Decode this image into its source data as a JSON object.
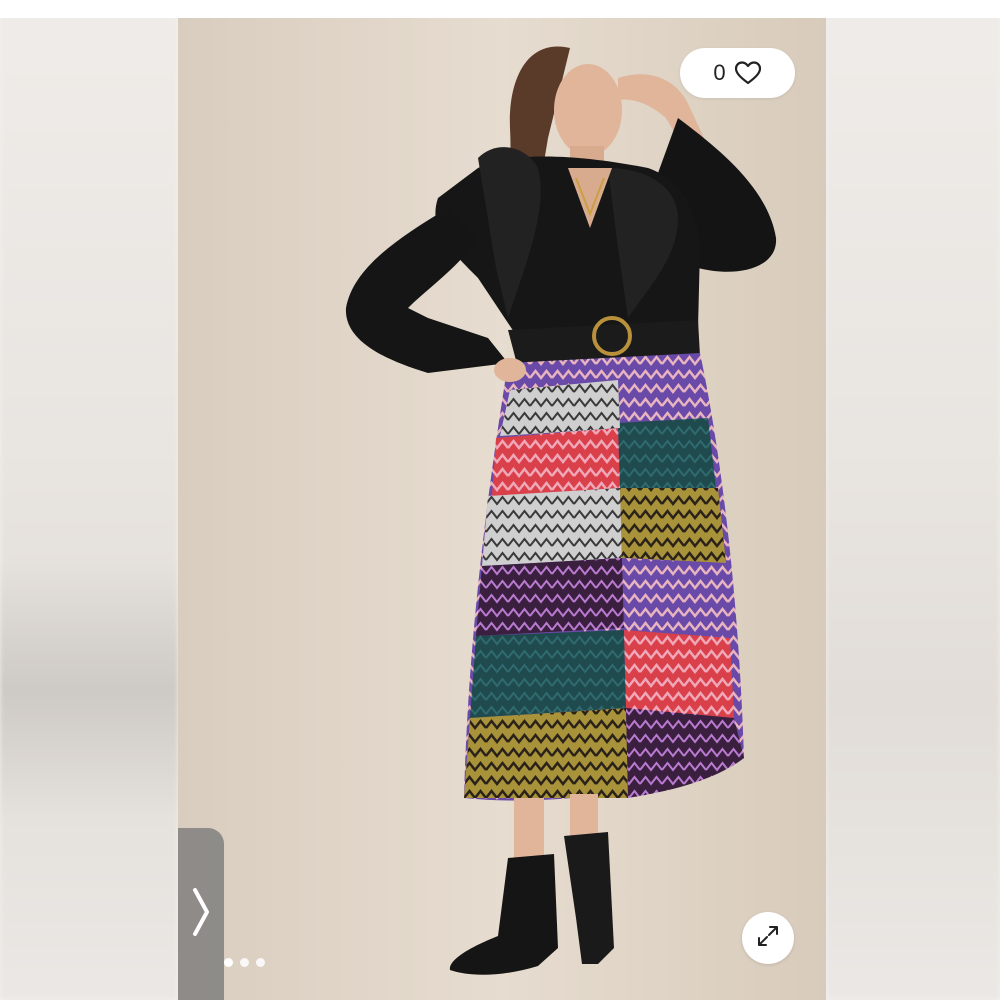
{
  "listing": {
    "like_count": "0",
    "icons": {
      "like": "heart-outline-icon",
      "expand": "expand-arrows-icon",
      "next": "chevron-right-icon"
    },
    "carousel": {
      "visible_dots": 3
    }
  },
  "colors": {
    "background": "#f4f1ee",
    "photo_backdrop": "#dccfc0",
    "overlay_button": "#787878",
    "pill": "#ffffff"
  }
}
